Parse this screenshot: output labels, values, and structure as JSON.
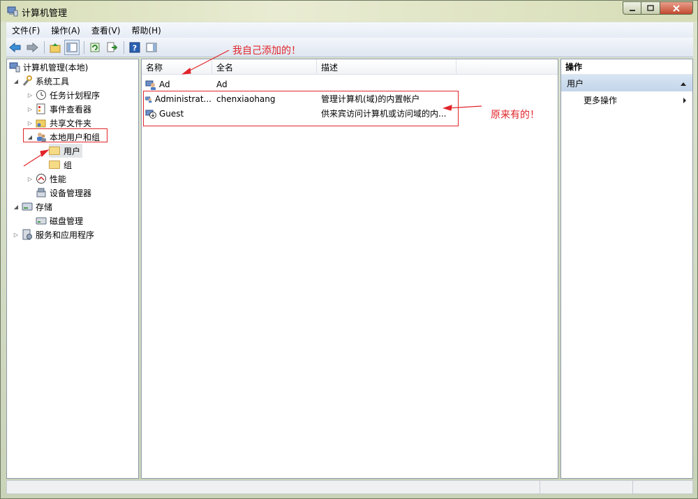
{
  "window": {
    "title": "计算机管理"
  },
  "menu": [
    "文件(F)",
    "操作(A)",
    "查看(V)",
    "帮助(H)"
  ],
  "toolbar": {
    "buttons": [
      "back-icon",
      "forward-icon",
      "up-folder-icon",
      "show-tree-icon",
      "refresh-icon",
      "export-list-icon",
      "help-icon",
      "show-action-pane-icon"
    ]
  },
  "tree": {
    "root": "计算机管理(本地)",
    "system_tools": "系统工具",
    "task_scheduler": "任务计划程序",
    "event_viewer": "事件查看器",
    "shared_folders": "共享文件夹",
    "local_users_groups": "本地用户和组",
    "users": "用户",
    "groups": "组",
    "performance": "性能",
    "device_manager": "设备管理器",
    "storage": "存储",
    "disk_management": "磁盘管理",
    "services_apps": "服务和应用程序"
  },
  "list": {
    "columns": [
      "名称",
      "全名",
      "描述"
    ],
    "rows": [
      {
        "name": "Ad",
        "full_name": "Ad",
        "description": ""
      },
      {
        "name": "Administrat...",
        "full_name": "chenxiaohang",
        "description": "管理计算机(域)的内置帐户"
      },
      {
        "name": "Guest",
        "full_name": "",
        "description": "供来宾访问计算机或访问域的内..."
      }
    ]
  },
  "annotations": {
    "added": "我自己添加的！",
    "original": "原来有的！",
    "color": "#e1252a"
  },
  "actions": {
    "title": "操作",
    "section": "用户",
    "more": "更多操作"
  }
}
